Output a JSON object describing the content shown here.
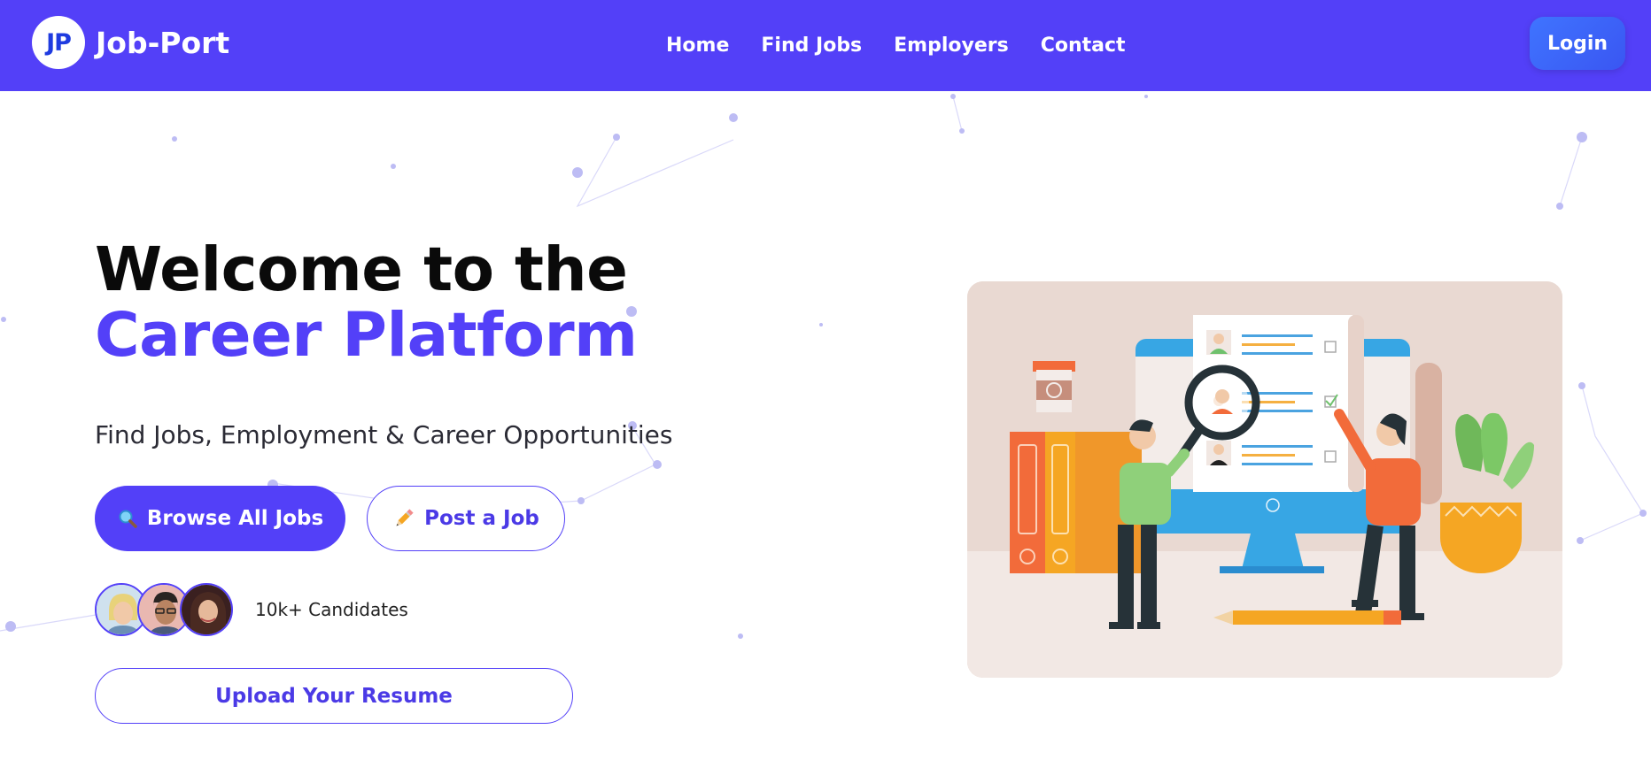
{
  "brand": {
    "logo_text": "JP",
    "name": "Job-Port"
  },
  "nav": {
    "items": [
      {
        "label": "Home"
      },
      {
        "label": "Find Jobs"
      },
      {
        "label": "Employers"
      },
      {
        "label": "Contact"
      }
    ],
    "login_label": "Login"
  },
  "colors": {
    "accent": "#5340f8",
    "login": "#3f74ff"
  },
  "hero": {
    "title_line1": "Welcome to the",
    "title_line2": "Career Platform",
    "subtitle": "Find Jobs, Employment & Career Opportunities",
    "browse_icon": "magnifier-icon",
    "browse_label": "Browse All Jobs",
    "post_icon": "pencil-icon",
    "post_label": "Post a Job",
    "candidates_label": "10k+ Candidates",
    "upload_label": "Upload Your Resume"
  },
  "illustration": {
    "icon": "recruitment-illustration"
  }
}
